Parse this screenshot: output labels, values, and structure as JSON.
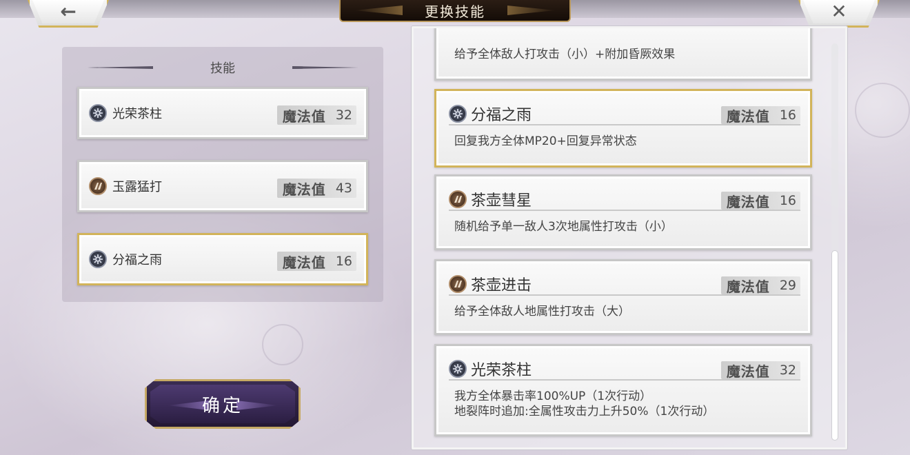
{
  "header": {
    "title": "更换技能",
    "back_icon": "←",
    "close_icon": "✕"
  },
  "equipped": {
    "heading": "技能",
    "slots": [
      {
        "name": "光荣茶柱",
        "element": "wind",
        "mp_label": "魔法值",
        "mp": "32",
        "selected": false
      },
      {
        "name": "玉露猛打",
        "element": "earth",
        "mp_label": "魔法值",
        "mp": "43",
        "selected": false
      },
      {
        "name": "分福之雨",
        "element": "wind",
        "mp_label": "魔法值",
        "mp": "16",
        "selected": true
      }
    ]
  },
  "confirm_label": "确定",
  "skill_list": {
    "partial_top": {
      "desc": "给予全体敌人打攻击（小）+附加昏厥效果"
    },
    "items": [
      {
        "name": "分福之雨",
        "element": "wind",
        "mp_label": "魔法值",
        "mp": "16",
        "selected": true,
        "desc": [
          "回复我方全体MP20+回复异常状态"
        ]
      },
      {
        "name": "茶壶彗星",
        "element": "earth",
        "mp_label": "魔法值",
        "mp": "16",
        "selected": false,
        "desc": [
          "随机给予单一敌人3次地属性打攻击（小）"
        ]
      },
      {
        "name": "茶壶进击",
        "element": "earth",
        "mp_label": "魔法值",
        "mp": "29",
        "selected": false,
        "desc": [
          "给予全体敌人地属性打攻击（大）"
        ]
      },
      {
        "name": "光荣茶柱",
        "element": "wind",
        "mp_label": "魔法值",
        "mp": "32",
        "selected": false,
        "desc": [
          "我方全体暴击率100%UP（1次行动）",
          "地裂阵时追加:全属性攻击力上升50%（1次行动）"
        ]
      }
    ]
  },
  "colors": {
    "gold_border": "#d2b45a",
    "title_bg": "#1e140c",
    "confirm_bg": "#3a2c52"
  }
}
